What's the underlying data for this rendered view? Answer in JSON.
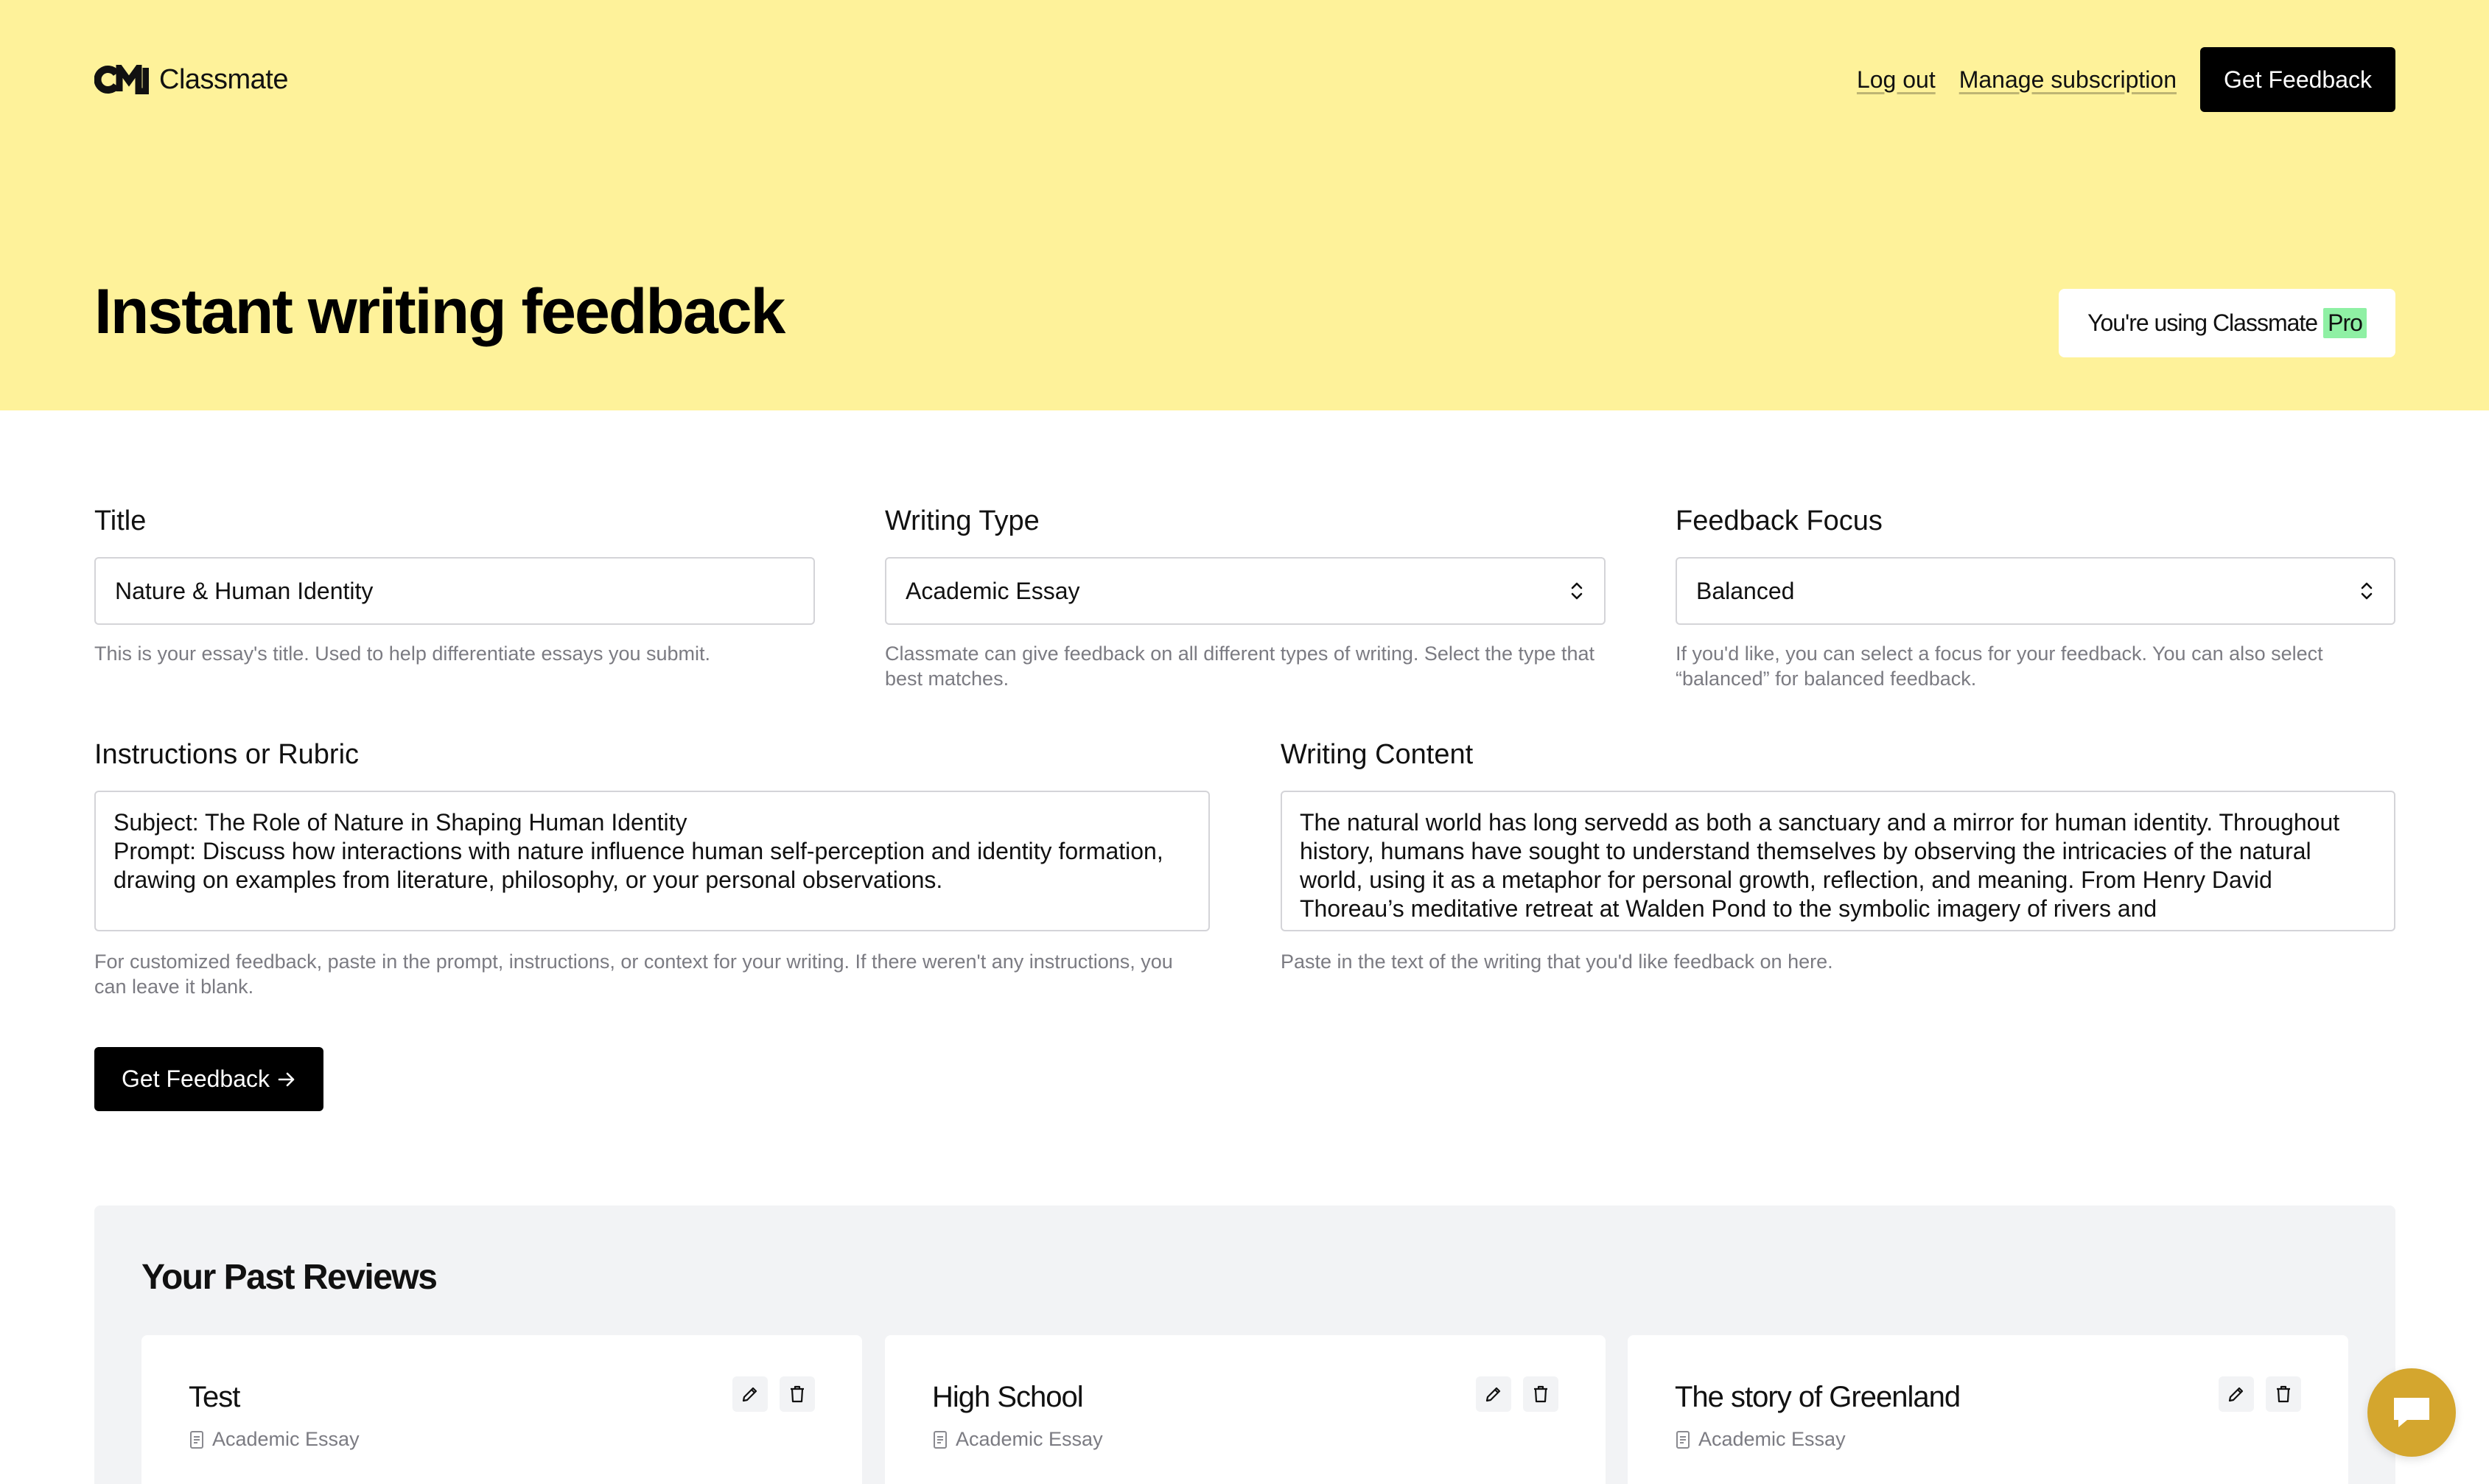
{
  "header": {
    "brand": "Classmate",
    "nav": {
      "logout": "Log out",
      "manage": "Manage subscription",
      "cta": "Get Feedback"
    }
  },
  "hero": {
    "title": "Instant writing feedback",
    "plan_prefix": "You're using Classmate",
    "plan_tag": "Pro"
  },
  "form": {
    "title": {
      "label": "Title",
      "value": "Nature & Human Identity",
      "help": "This is your essay's title. Used to help differentiate essays you submit."
    },
    "writing_type": {
      "label": "Writing Type",
      "value": "Academic Essay",
      "help": "Classmate can give feedback on all different types of writing. Select the type that best matches."
    },
    "feedback_focus": {
      "label": "Feedback Focus",
      "value": "Balanced",
      "help": "If you'd like, you can select a focus for your feedback. You can also select “balanced” for balanced feedback."
    },
    "instructions": {
      "label": "Instructions or Rubric",
      "value": "Subject: The Role of Nature in Shaping Human Identity\nPrompt: Discuss how interactions with nature influence human self-perception and identity formation, drawing on examples from literature, philosophy, or your personal observations.",
      "help": "For customized feedback, paste in the prompt, instructions, or context for your writing. If there weren't any instructions, you can leave it blank."
    },
    "content": {
      "label": "Writing Content",
      "value": "The natural world has long servedd as both a sanctuary and a mirror for human identity. Throughout history, humans have sought to understand themselves by observing the intricacies of the natural world, using it as a metaphor for personal growth, reflection, and meaning. From Henry David Thoreau’s meditative retreat at Walden Pond to the symbolic imagery of rivers and",
      "help": "Paste in the text of the writing that you'd like feedback on here."
    },
    "submit": "Get Feedback"
  },
  "past_reviews": {
    "title": "Your Past Reviews",
    "items": [
      {
        "title": "Test",
        "type": "Academic Essay"
      },
      {
        "title": "High School",
        "type": "Academic Essay"
      },
      {
        "title": "The story of Greenland",
        "type": "Academic Essay"
      }
    ]
  },
  "colors": {
    "hero_bg": "#FEF29A",
    "pro_tag": "#8FF0A4",
    "chat_fab": "#D4A62E"
  },
  "icons": [
    "classmate-logo",
    "chevron-updown-icon",
    "arrow-right-icon",
    "pencil-icon",
    "trash-icon",
    "document-icon",
    "chat-icon"
  ]
}
